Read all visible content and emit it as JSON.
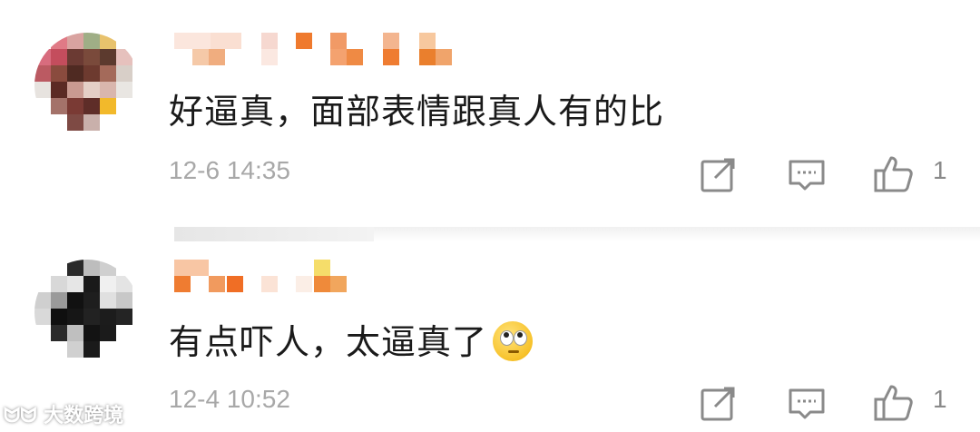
{
  "comments": [
    {
      "text": "好逼真，面部表情跟真人有的比",
      "time": "12-6 14:35",
      "likes": "1"
    },
    {
      "text": "有点吓人，太逼真了",
      "emoji": "eye-roll-emoji",
      "time": "12-4 10:52",
      "likes": "1"
    }
  ],
  "icons": {
    "share": "share-icon",
    "reply": "comment-icon",
    "like": "thumbs-up-icon"
  },
  "colors": {
    "text": "#1a1a1a",
    "meta": "#a8a8a8",
    "icon": "#8a8a8a"
  }
}
